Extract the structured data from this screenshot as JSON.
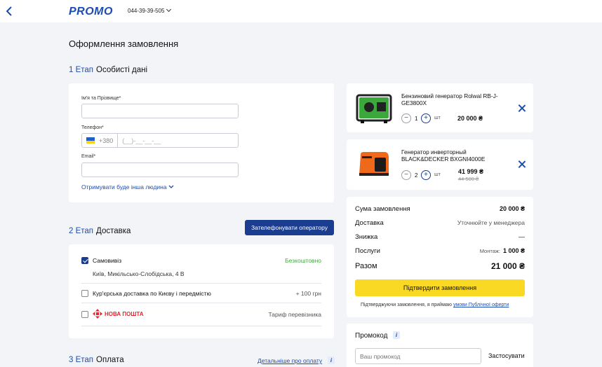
{
  "header": {
    "logo": "PROMO",
    "phone": "044-39-39-505"
  },
  "page_title": "Оформлення замовлення",
  "step1": {
    "num": "1 Етап",
    "title": "Особисті дані",
    "name_label": "Ім'я та Прізвище*",
    "phone_label": "Телефон*",
    "phone_code": "+380",
    "phone_mask": "(__)-__-__-__",
    "email_label": "Email*",
    "other_person_link": "Отримувати буде інша людина"
  },
  "step2": {
    "num": "2 Етап",
    "title": "Доставка",
    "call_button": "Зателефонувати оператору",
    "options": [
      {
        "label": "Самовивіз",
        "price": "Безкоштовно",
        "address": "Київ, Микільсько-Слобідська, 4 В",
        "checked": true
      },
      {
        "label": "Кур'єрська доставка по Києву і передмістю",
        "price": "+ 100 грн",
        "checked": false
      },
      {
        "label": "НОВА ПОШТА",
        "price": "Тариф перевізника",
        "checked": false
      }
    ]
  },
  "step3": {
    "num": "3 Етап",
    "title": "Оплата",
    "details_link": "Детальніше про оплату"
  },
  "cart": {
    "items": [
      {
        "name": "Бензиновий генератор Rolwal RB-J-GE3800X",
        "qty": "1",
        "unit": "шт",
        "price": "20 000 ₴",
        "old_price": ""
      },
      {
        "name": "Генератор инверторный BLACK&DECKER BXGNI4000E",
        "qty": "2",
        "unit": "шт",
        "price": "41 999 ₴",
        "old_price": "44 500 ₴"
      }
    ]
  },
  "summary": {
    "order_sum_label": "Сума замовлення",
    "order_sum_value": "20 000 ₴",
    "delivery_label": "Доставка",
    "delivery_value": "Уточнюйте у менеджера",
    "discount_label": "Знижка",
    "discount_value": "—",
    "services_label": "Послуги",
    "services_sub": "Монтаж:",
    "services_value": "1 000 ₴",
    "total_label": "Разом",
    "total_value": "21 000 ₴",
    "confirm_button": "Підтвердити замовлення",
    "terms_prefix": "Підтверджуючи замовлення, я приймаю",
    "terms_link": "умови Публічної оферти"
  },
  "promo": {
    "title": "Промокод",
    "placeholder": "Ваш промокод",
    "apply_button": "Застосувати"
  },
  "colors": {
    "accent": "#1a4db3",
    "button_dark": "#1a3d8f",
    "confirm": "#f9d923",
    "free": "#3cae3c",
    "novaposhta": "#e3262f"
  }
}
